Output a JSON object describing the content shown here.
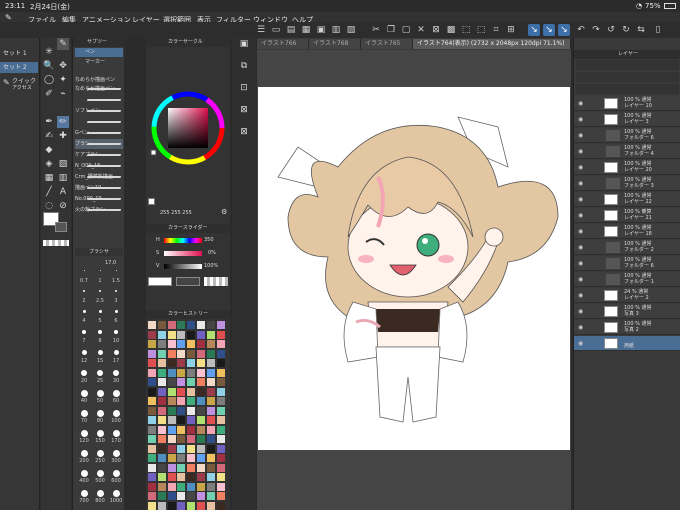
{
  "status": {
    "time": "23:11",
    "date": "2月24日(金)",
    "battery": "75%"
  },
  "menu": [
    "ファイル",
    "編集",
    "アニメーション",
    "レイヤー",
    "選択範囲",
    "表示",
    "フィルター",
    "ウィンドウ",
    "ヘルプ"
  ],
  "left_sets": {
    "set1": "セット 1",
    "set2": "セット 2",
    "quick": "クイック",
    "quick_sub": "アクセス"
  },
  "subtool": {
    "tab1": "サブツー",
    "tab2": "ペン",
    "tab3": "マーカー",
    "header": "なめらか描画ペン",
    "items": [
      "なめらか描画ペン",
      "",
      "ソフトペン",
      "",
      "Gペン",
      "ブラシ",
      "ケアプラシ",
      "N_O09_16",
      "Crm_野菜影描画",
      "描画ペン10",
      "No.000_19",
      "火の粉ブラシ"
    ],
    "brush_size_label": "ブラシサ",
    "brush_value": "17.0",
    "sizes": [
      "0.7",
      "1",
      "1.5",
      "2",
      "2.5",
      "3",
      "4",
      "5",
      "6",
      "7",
      "8",
      "10",
      "12",
      "15",
      "17",
      "20",
      "25",
      "30",
      "40",
      "50",
      "60",
      "70",
      "80",
      "100",
      "120",
      "150",
      "170",
      "200",
      "250",
      "300",
      "400",
      "500",
      "600",
      "700",
      "800",
      "1000"
    ]
  },
  "color": {
    "circle_title": "カラーサークル",
    "rgb": "255 255 255",
    "slider_title": "カラースライダー",
    "h_label": "H",
    "h_value": "350",
    "s_label": "S",
    "s_value": "0%",
    "v_label": "V",
    "v_value": "100%",
    "history_title": "カラーヒストリー"
  },
  "tabs": [
    "イラスト766",
    "イラスト768",
    "イラスト765",
    "イラスト764(表示) (2732 x 2048px 120dpi 71.1%)"
  ],
  "layer_panel": {
    "title": "レイヤー",
    "layers": [
      {
        "pct": "100 % 通常",
        "name": "レイヤー 10"
      },
      {
        "pct": "100 % 通常",
        "name": "レイヤー 3"
      },
      {
        "pct": "100 % 通常",
        "name": "フォルダー 6"
      },
      {
        "pct": "100 % 通常",
        "name": "フォルダー 4"
      },
      {
        "pct": "100 % 通常",
        "name": "レイヤー 20"
      },
      {
        "pct": "100 % 通常",
        "name": "フォルダー 3"
      },
      {
        "pct": "100 % 通常",
        "name": "レイヤー 22"
      },
      {
        "pct": "100 % 乗算",
        "name": "レイヤー 21"
      },
      {
        "pct": "100 % 通常",
        "name": "レイヤー 18"
      },
      {
        "pct": "100 % 通常",
        "name": "フォルダー 2"
      },
      {
        "pct": "100 % 通常",
        "name": "フォルダー 6"
      },
      {
        "pct": "100 % 通常",
        "name": "フォルダー 1"
      },
      {
        "pct": "24 % 通常",
        "name": "レイヤー 2"
      },
      {
        "pct": "100 % 通常",
        "name": "写真 3"
      },
      {
        "pct": "100 % 通常",
        "name": "写真 2"
      },
      {
        "pct": "",
        "name": "用紙"
      }
    ]
  },
  "colors": {
    "accent": "#3d6fa8",
    "canvas_bg": "#454545",
    "panel": "#3a3a3a"
  }
}
